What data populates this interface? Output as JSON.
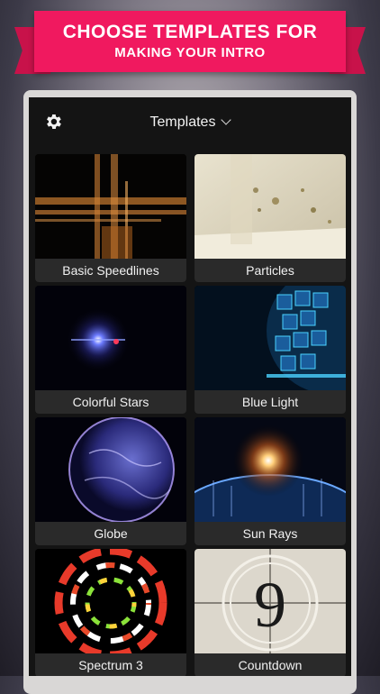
{
  "banner": {
    "line1": "CHOOSE TEMPLATES FOR",
    "line2": "MAKING YOUR INTRO"
  },
  "header": {
    "title": "Templates",
    "settings_icon": "gear-icon",
    "dropdown_icon": "chevron-down-icon"
  },
  "templates": [
    {
      "label": "Basic Speedlines"
    },
    {
      "label": "Particles"
    },
    {
      "label": "Colorful Stars"
    },
    {
      "label": "Blue Light"
    },
    {
      "label": "Globe"
    },
    {
      "label": "Sun Rays"
    },
    {
      "label": "Spectrum 3"
    },
    {
      "label": "Countdown"
    }
  ],
  "countdown_digit": "9",
  "colors": {
    "banner": "#f0195f",
    "ribbon": "#c8124a",
    "label_bg": "#2a2a2a"
  }
}
